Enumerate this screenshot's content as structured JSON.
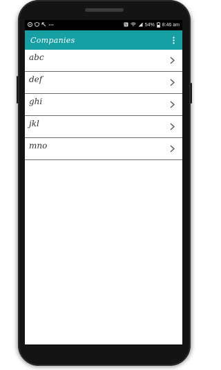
{
  "status_bar": {
    "battery": "54%",
    "time": "8:46 am"
  },
  "toolbar": {
    "title": "Companies",
    "overflow_icon": "more-vert-icon"
  },
  "list": {
    "items": [
      {
        "label": "abc"
      },
      {
        "label": "def"
      },
      {
        "label": "ghi"
      },
      {
        "label": "jkl"
      },
      {
        "label": "mno"
      }
    ],
    "chevron_icon": "chevron-right-icon"
  },
  "colors": {
    "toolbar": "#16a0a3",
    "divider": "#6b6b6b",
    "text": "#333333"
  }
}
